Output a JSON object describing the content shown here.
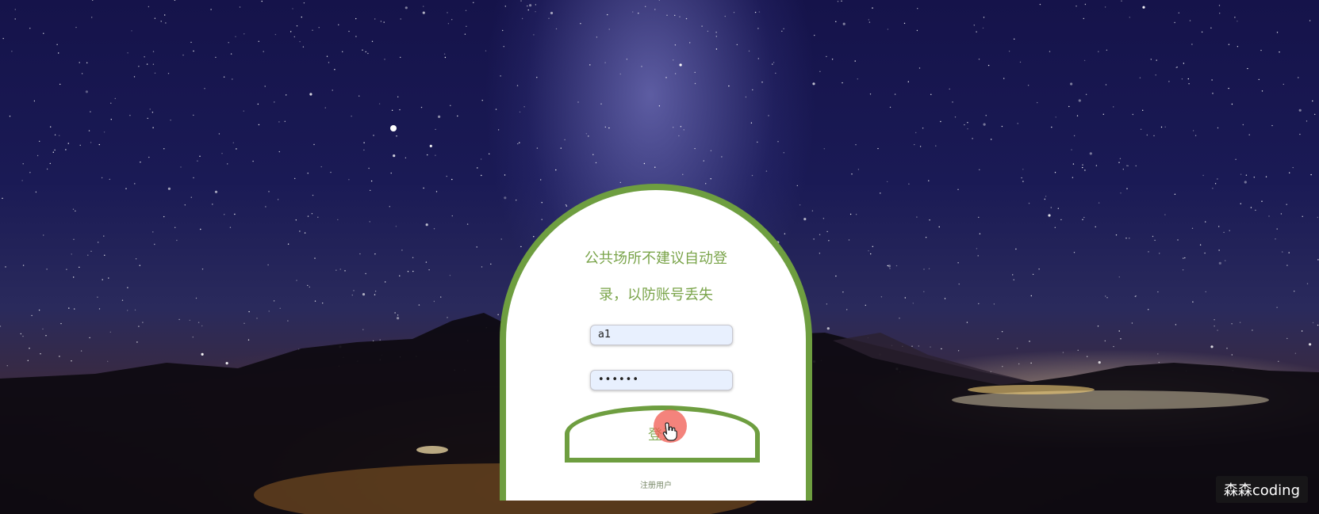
{
  "login": {
    "notice": "公共场所不建议自动登录，以防账号丢失",
    "username_value": "a1",
    "password_value": "••••••",
    "login_button": "登录",
    "register_link": "注册用户"
  },
  "watermark": "森森coding",
  "colors": {
    "accent": "#6e9e40",
    "title_text": "#7aa44a",
    "input_bg": "#e8f0fe",
    "cursor_highlight": "#f05a50"
  }
}
